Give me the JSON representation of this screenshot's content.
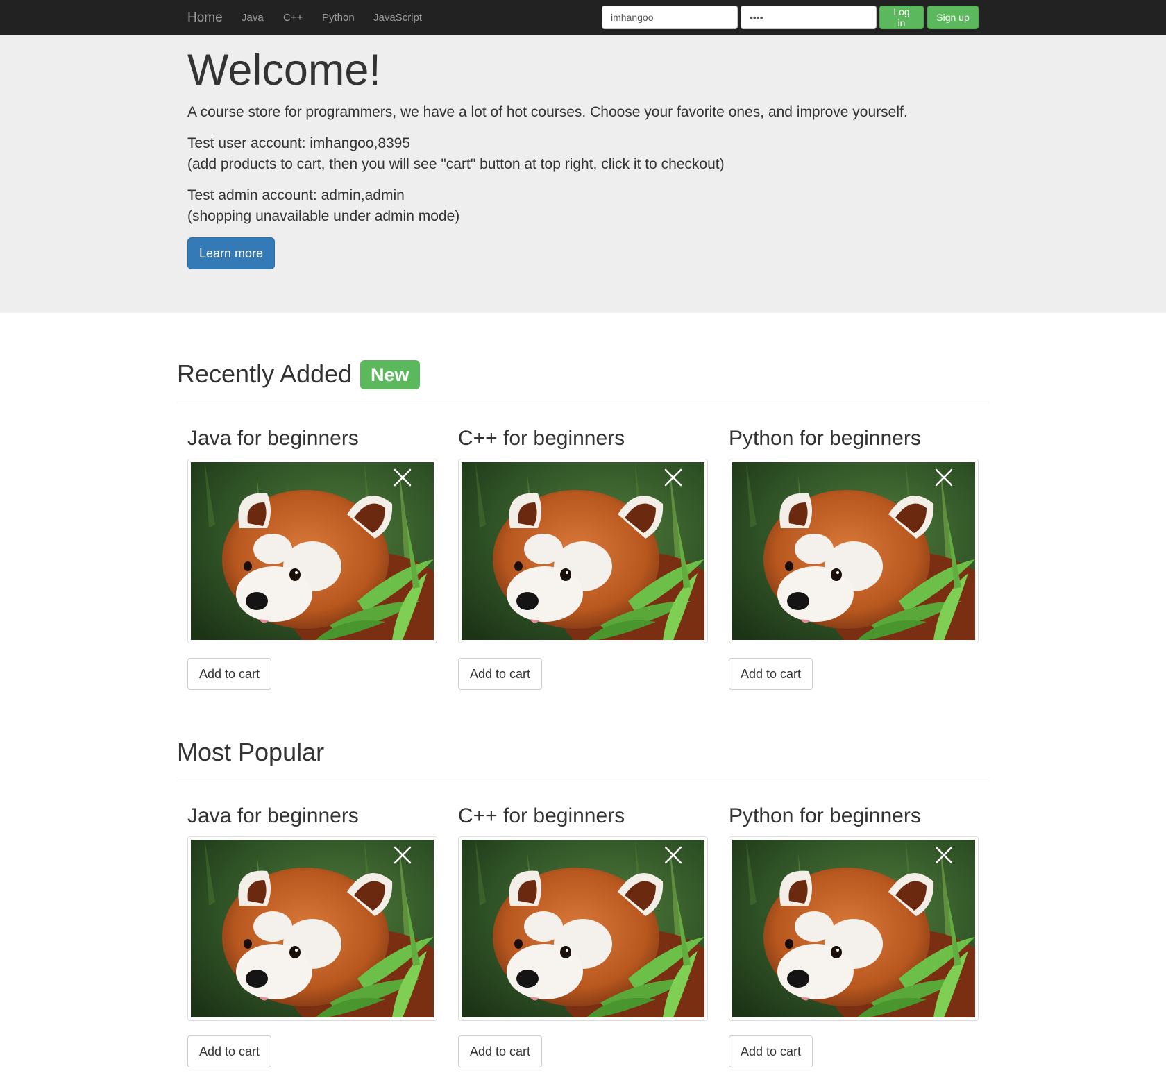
{
  "navbar": {
    "brand": "Home",
    "links": [
      "Java",
      "C++",
      "Python",
      "JavaScript"
    ],
    "username_value": "imhangoo",
    "password_value": "••••",
    "login_label": "Log in",
    "signup_label": "Sign up"
  },
  "jumbotron": {
    "title": "Welcome!",
    "lead": "A course store for programmers, we have a lot of hot courses. Choose your favorite ones, and improve yourself.",
    "user_account": "Test user account: imhangoo,8395",
    "user_note": "(add products to cart, then you will see \"cart\" button at top right, click it to checkout)",
    "admin_account": "Test admin account: admin,admin",
    "admin_note": "(shopping unavailable under admin mode)",
    "learn_more_label": "Learn more"
  },
  "recent": {
    "title": "Recently Added",
    "badge": "New",
    "products": [
      {
        "title": "Java for beginners",
        "cart_label": "Add to cart"
      },
      {
        "title": "C++ for beginners",
        "cart_label": "Add to cart"
      },
      {
        "title": "Python for beginners",
        "cart_label": "Add to cart"
      }
    ]
  },
  "popular": {
    "title": "Most Popular",
    "products": [
      {
        "title": "Java for beginners",
        "cart_label": "Add to cart"
      },
      {
        "title": "C++ for beginners",
        "cart_label": "Add to cart"
      },
      {
        "title": "Python for beginners",
        "cart_label": "Add to cart"
      }
    ]
  },
  "colors": {
    "navbar": "#222222",
    "jumbotron": "#eeeeee",
    "success": "#5cb85c",
    "primary": "#337ab7"
  },
  "icons": {
    "product_image": "red-panda-photo",
    "overlay": "close-icon"
  }
}
